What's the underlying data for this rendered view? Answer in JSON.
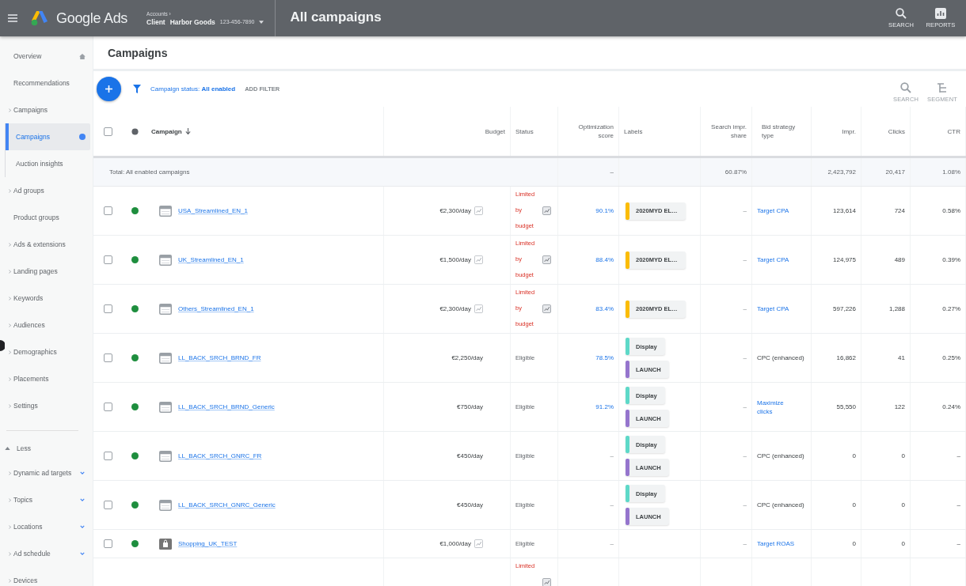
{
  "top_bar": {
    "product": "Google Ads",
    "account": {
      "breadcrumb": "Accounts ›",
      "type": "Client",
      "name": "Harbor Goods",
      "id": "123-456-7890"
    },
    "title": "All campaigns",
    "tools": [
      {
        "kind": "search",
        "label": "SEARCH"
      },
      {
        "kind": "reports",
        "label": "REPORTS"
      }
    ]
  },
  "sidebar": {
    "items": [
      {
        "label": "Overview",
        "kind": "home",
        "selected": false
      },
      {
        "label": "Recommendations",
        "kind": "page",
        "selected": false
      },
      {
        "label": "Campaigns",
        "kind": "section",
        "selected": false,
        "children": [
          {
            "label": "Campaigns",
            "selected": true
          },
          {
            "label": "Auction insights",
            "selected": false
          }
        ]
      },
      {
        "label": "Ad groups",
        "kind": "section",
        "selected": false
      },
      {
        "label": "Product groups",
        "kind": "page",
        "selected": false
      },
      {
        "label": "Ads & extensions",
        "kind": "section",
        "selected": false
      },
      {
        "label": "Landing pages",
        "kind": "section",
        "selected": false
      },
      {
        "label": "Keywords",
        "kind": "section",
        "selected": false
      },
      {
        "label": "Audiences",
        "kind": "section",
        "selected": false
      },
      {
        "label": "Demographics",
        "kind": "section",
        "selected": false
      },
      {
        "label": "Placements",
        "kind": "section",
        "selected": false
      },
      {
        "label": "Settings",
        "kind": "section",
        "selected": false
      }
    ],
    "toggle": {
      "label": "Less",
      "expanded": true
    },
    "more_items": [
      {
        "label": "Dynamic ad targets",
        "kind": "extra",
        "selected": false
      },
      {
        "label": "Topics",
        "kind": "extra",
        "selected": false
      },
      {
        "label": "Locations",
        "kind": "extra",
        "selected": false
      },
      {
        "label": "Ad schedule",
        "kind": "extra",
        "selected": false
      },
      {
        "label": "Devices",
        "kind": "section",
        "selected": false
      }
    ]
  },
  "page": {
    "title": "Campaigns"
  },
  "filter_bar": {
    "filter": "Campaign status: **All enabled**",
    "add_filter": "ADD FILTER",
    "tools": [
      {
        "kind": "search",
        "label": "SEARCH"
      },
      {
        "kind": "segment",
        "label": "SEGMENT"
      }
    ]
  },
  "table": {
    "select_all": {
      "checked": false
    },
    "columns": [
      {
        "label": "Campaign",
        "sorted": true
      },
      {
        "label": "Budget",
        "sorted": false
      },
      {
        "label": "Status",
        "sorted": false
      },
      {
        "label": "Optimization score",
        "sorted": false
      },
      {
        "label": "Labels",
        "sorted": false
      },
      {
        "label": "Search impr. share",
        "sorted": false
      },
      {
        "label": "Bid strategy type",
        "sorted": false
      },
      {
        "label": "Impr.",
        "sorted": false
      },
      {
        "label": "Clicks",
        "sorted": false
      },
      {
        "label": "CTR",
        "sorted": false
      }
    ],
    "total": {
      "label": "Total: All enabled campaigns",
      "optimization_score": "–",
      "search_impr_share": "60.87%",
      "impr": "2,423,792",
      "clicks": "20,417",
      "ctr": "1.08%"
    },
    "rows": [
      {
        "checked": false,
        "enabled": true,
        "kind": "search",
        "campaign": "USA_Streamlined_EN_1",
        "budget": "€2,300/day",
        "budget_note": true,
        "status": {
          "text": "Limited by budget",
          "limited": true
        },
        "optimization_score": {
          "text": "90.1%",
          "link": true
        },
        "labels": [
          {
            "text": "2020MYD EL…",
            "color": "#fbbc04"
          }
        ],
        "search_impr_share": "–",
        "bid_strategy": {
          "text": "Target CPA",
          "link": true
        },
        "impr": "123,614",
        "clicks": "724",
        "ctr": "0.58%"
      },
      {
        "checked": false,
        "enabled": true,
        "kind": "search",
        "campaign": "UK_Streamlined_EN_1",
        "budget": "€1,500/day",
        "budget_note": true,
        "status": {
          "text": "Limited by budget",
          "limited": true
        },
        "optimization_score": {
          "text": "88.4%",
          "link": true
        },
        "labels": [
          {
            "text": "2020MYD EL…",
            "color": "#fbbc04"
          }
        ],
        "search_impr_share": "–",
        "bid_strategy": {
          "text": "Target CPA",
          "link": true
        },
        "impr": "124,975",
        "clicks": "489",
        "ctr": "0.39%"
      },
      {
        "checked": false,
        "enabled": true,
        "kind": "search",
        "campaign": "Others_Streamlined_EN_1",
        "budget": "€2,300/day",
        "budget_note": true,
        "status": {
          "text": "Limited by budget",
          "limited": true
        },
        "optimization_score": {
          "text": "83.4%",
          "link": true
        },
        "labels": [
          {
            "text": "2020MYD EL…",
            "color": "#fbbc04"
          }
        ],
        "search_impr_share": "–",
        "bid_strategy": {
          "text": "Target CPA",
          "link": true
        },
        "impr": "597,226",
        "clicks": "1,288",
        "ctr": "0.27%"
      },
      {
        "checked": false,
        "enabled": true,
        "kind": "search",
        "campaign": "LL_BACK_SRCH_BRND_FR",
        "budget": "€2,250/day",
        "budget_note": false,
        "status": {
          "text": "Eligible",
          "limited": false
        },
        "optimization_score": {
          "text": "78.5%",
          "link": true
        },
        "labels": [
          {
            "text": "Display",
            "color": "#5ed9c8"
          },
          {
            "text": "LAUNCH",
            "color": "#9575cd"
          }
        ],
        "search_impr_share": "–",
        "bid_strategy": {
          "text": "CPC (enhanced)",
          "link": false
        },
        "impr": "16,862",
        "clicks": "41",
        "ctr": "0.25%"
      },
      {
        "checked": false,
        "enabled": true,
        "kind": "search",
        "campaign": "LL_BACK_SRCH_BRND_Generic",
        "budget": "€750/day",
        "budget_note": false,
        "status": {
          "text": "Eligible",
          "limited": false
        },
        "optimization_score": {
          "text": "91.2%",
          "link": true
        },
        "labels": [
          {
            "text": "Display",
            "color": "#5ed9c8"
          },
          {
            "text": "LAUNCH",
            "color": "#9575cd"
          }
        ],
        "search_impr_share": "–",
        "bid_strategy": {
          "text": "Maximize clicks",
          "link": true
        },
        "impr": "55,550",
        "clicks": "122",
        "ctr": "0.24%"
      },
      {
        "checked": false,
        "enabled": true,
        "kind": "search",
        "campaign": "LL_BACK_SRCH_GNRC_FR",
        "budget": "€450/day",
        "budget_note": false,
        "status": {
          "text": "Eligible",
          "limited": false
        },
        "optimization_score": {
          "text": "–",
          "link": false
        },
        "labels": [
          {
            "text": "Display",
            "color": "#5ed9c8"
          },
          {
            "text": "LAUNCH",
            "color": "#9575cd"
          }
        ],
        "search_impr_share": "–",
        "bid_strategy": {
          "text": "CPC (enhanced)",
          "link": false
        },
        "impr": "0",
        "clicks": "0",
        "ctr": "–"
      },
      {
        "checked": false,
        "enabled": true,
        "kind": "search",
        "campaign": "LL_BACK_SRCH_GNRC_Generic",
        "budget": "€450/day",
        "budget_note": false,
        "status": {
          "text": "Eligible",
          "limited": false
        },
        "optimization_score": {
          "text": "–",
          "link": false
        },
        "labels": [
          {
            "text": "Display",
            "color": "#5ed9c8"
          },
          {
            "text": "LAUNCH",
            "color": "#9575cd"
          }
        ],
        "search_impr_share": "–",
        "bid_strategy": {
          "text": "CPC (enhanced)",
          "link": false
        },
        "impr": "0",
        "clicks": "0",
        "ctr": "–"
      },
      {
        "checked": false,
        "enabled": true,
        "kind": "shopping",
        "campaign": "Shopping_UK_TEST",
        "budget": "€1,000/day",
        "budget_note": true,
        "status": {
          "text": "Eligible",
          "limited": false
        },
        "optimization_score": {
          "text": "–",
          "link": false
        },
        "search_impr_share": "–",
        "bid_strategy": {
          "text": "Target ROAS",
          "link": true
        },
        "impr": "0",
        "clicks": "0",
        "ctr": "–"
      },
      {
        "status": {
          "text": "Limited",
          "limited": true
        }
      }
    ]
  }
}
